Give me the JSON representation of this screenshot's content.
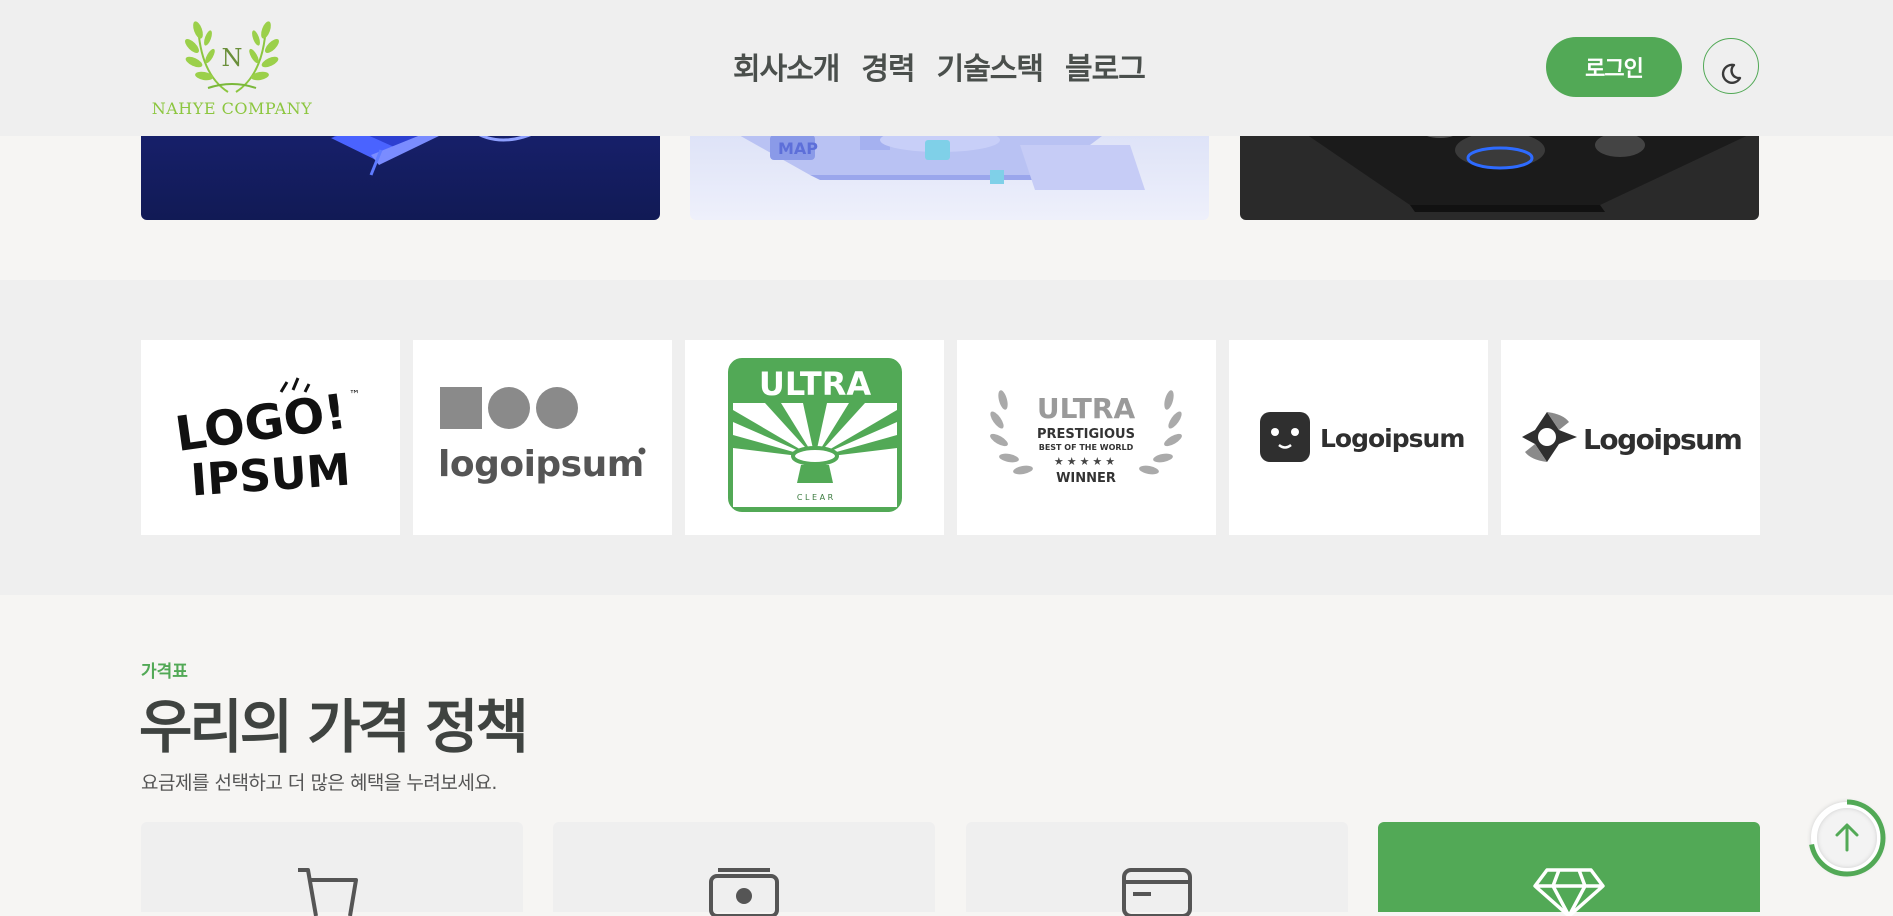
{
  "header": {
    "logo_text": "NAHYE COMPANY",
    "logo_letter": "N",
    "nav": [
      "회사소개",
      "경력",
      "기술스택",
      "블로그"
    ],
    "login_label": "로그인",
    "theme_icon": "moon-icon"
  },
  "clients": {
    "logos": [
      {
        "name": "logo-ipsum-playful",
        "line1": "LOGO!",
        "line2": "IPSUM",
        "tm": "™"
      },
      {
        "name": "logoipsum-shapes",
        "text": "logoipsum"
      },
      {
        "name": "ultra-clear",
        "top": "ULTRA",
        "bottom": "C L E A R"
      },
      {
        "name": "ultra-winner",
        "line1": "ULTRA",
        "line2": "PRESTIGIOUS",
        "line3": "BEST OF THE WORLD",
        "stars": "★★★★★",
        "line4": "WINNER"
      },
      {
        "name": "logoipsum-face",
        "text": "Logoipsum"
      },
      {
        "name": "logoipsum-diamond",
        "text": "Logoipsum"
      }
    ]
  },
  "pricing": {
    "eyebrow": "가격표",
    "title": "우리의 가격 정책",
    "description": "요금제를 선택하고 더 많은 혜택을 누려보세요.",
    "cards": [
      {
        "icon": "cart-icon",
        "featured": false
      },
      {
        "icon": "banknote-icon",
        "featured": false
      },
      {
        "icon": "credit-card-icon",
        "featured": false
      },
      {
        "icon": "diamond-icon",
        "featured": true
      }
    ]
  },
  "scroll_top": {
    "icon": "arrow-up-icon",
    "progress": 0.72
  },
  "colors": {
    "accent": "#52a956",
    "header_bg": "#efefef",
    "page_bg": "#f6f5f3",
    "text_dark": "#3f4340"
  }
}
